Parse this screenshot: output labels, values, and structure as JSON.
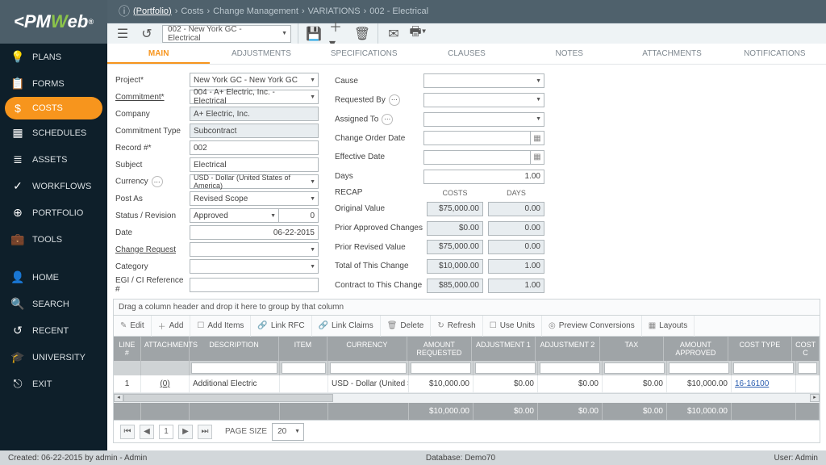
{
  "header": {
    "logo_pre": "PM",
    "logo_mid": "W",
    "logo_post": "eb",
    "logo_reg": "®",
    "breadcrumb": [
      "(Portfolio)",
      "Costs",
      "Change Management",
      "VARIATIONS",
      "002 - Electrical"
    ],
    "record_selector": "002 - New York GC - Electrical"
  },
  "sidebar": [
    {
      "icon": "💡",
      "label": "PLANS",
      "active": false
    },
    {
      "icon": "📋",
      "label": "FORMS",
      "active": false
    },
    {
      "icon": "$",
      "label": "COSTS",
      "active": true
    },
    {
      "icon": "▦",
      "label": "SCHEDULES",
      "active": false
    },
    {
      "icon": "≣",
      "label": "ASSETS",
      "active": false
    },
    {
      "icon": "✓",
      "label": "WORKFLOWS",
      "active": false
    },
    {
      "icon": "⊕",
      "label": "PORTFOLIO",
      "active": false
    },
    {
      "icon": "💼",
      "label": "TOOLS",
      "active": false
    },
    {
      "icon": "👤",
      "label": "HOME",
      "active": false
    },
    {
      "icon": "🔍",
      "label": "SEARCH",
      "active": false
    },
    {
      "icon": "↺",
      "label": "RECENT",
      "active": false
    },
    {
      "icon": "🎓",
      "label": "UNIVERSITY",
      "active": false
    },
    {
      "icon": "⎋",
      "label": "EXIT",
      "active": false
    }
  ],
  "tabs": [
    "MAIN",
    "ADJUSTMENTS",
    "SPECIFICATIONS",
    "CLAUSES",
    "NOTES",
    "ATTACHMENTS",
    "NOTIFICATIONS"
  ],
  "active_tab": 0,
  "form": {
    "left": {
      "project_label": "Project*",
      "project": "New York GC - New York GC",
      "commitment_label": "Commitment*",
      "commitment": "004 - A+ Electric, Inc. - Electrical",
      "company_label": "Company",
      "company": "A+ Electric, Inc.",
      "commit_type_label": "Commitment Type",
      "commit_type": "Subcontract",
      "record_label": "Record #*",
      "record": "002",
      "subject_label": "Subject",
      "subject": "Electrical",
      "currency_label": "Currency",
      "currency": "USD - Dollar (United States of America)",
      "postas_label": "Post As",
      "postas": "Revised Scope",
      "status_label": "Status / Revision",
      "status": "Approved",
      "status_rev": "0",
      "date_label": "Date",
      "date": "06-22-2015",
      "cr_label": "Change Request",
      "cr": "",
      "category_label": "Category",
      "category": "",
      "egi_label": "EGI / CI Reference #",
      "egi": ""
    },
    "right": {
      "cause_label": "Cause",
      "cause": "",
      "reqby_label": "Requested By",
      "reqby": "",
      "assigned_label": "Assigned To",
      "assigned": "",
      "co_date_label": "Change Order Date",
      "co_date": "",
      "eff_date_label": "Effective Date",
      "eff_date": "",
      "days_label": "Days",
      "days": "1.00",
      "recap_label": "RECAP",
      "costs_hdr": "COSTS",
      "days_hdr": "DAYS",
      "orig_label": "Original Value",
      "orig_c": "$75,000.00",
      "orig_d": "0.00",
      "prior_label": "Prior Approved Changes",
      "prior_c": "$0.00",
      "prior_d": "0.00",
      "prv_label": "Prior Revised Value",
      "prv_c": "$75,000.00",
      "prv_d": "0.00",
      "tot_label": "Total of This Change",
      "tot_c": "$10,000.00",
      "tot_d": "1.00",
      "ctt_label": "Contract to This Change",
      "ctt_c": "$85,000.00",
      "ctt_d": "1.00"
    }
  },
  "grid": {
    "group_text": "Drag a column header and drop it here to group by that column",
    "toolbar": {
      "edit": "Edit",
      "add": "Add",
      "additems": "Add Items",
      "linkrfc": "Link RFC",
      "linkclaims": "Link Claims",
      "delete": "Delete",
      "refresh": "Refresh",
      "useunits": "Use Units",
      "preview": "Preview Conversions",
      "layouts": "Layouts"
    },
    "cols": [
      "LINE #",
      "ATTACHMENTS",
      "DESCRIPTION",
      "ITEM",
      "CURRENCY",
      "AMOUNT REQUESTED",
      "ADJUSTMENT 1",
      "ADJUSTMENT 2",
      "TAX",
      "AMOUNT APPROVED",
      "COST TYPE",
      "COST C"
    ],
    "row": {
      "line": "1",
      "att": "(0)",
      "desc": "Additional Electric",
      "item": "",
      "cur": "USD - Dollar (United States of America)",
      "amtreq": "$10,000.00",
      "adj1": "$0.00",
      "adj2": "$0.00",
      "tax": "$0.00",
      "amtapp": "$10,000.00",
      "cost": "16-16100"
    },
    "totals": {
      "amtreq": "$10,000.00",
      "adj1": "$0.00",
      "adj2": "$0.00",
      "tax": "$0.00",
      "amtapp": "$10,000.00"
    },
    "pager": {
      "page": "1",
      "page_size_lbl": "PAGE SIZE",
      "page_size": "20"
    }
  },
  "status": {
    "created": "Created:  06-22-2015 by admin - Admin",
    "db": "Database:   Demo70",
    "user": "User:  Admin"
  }
}
